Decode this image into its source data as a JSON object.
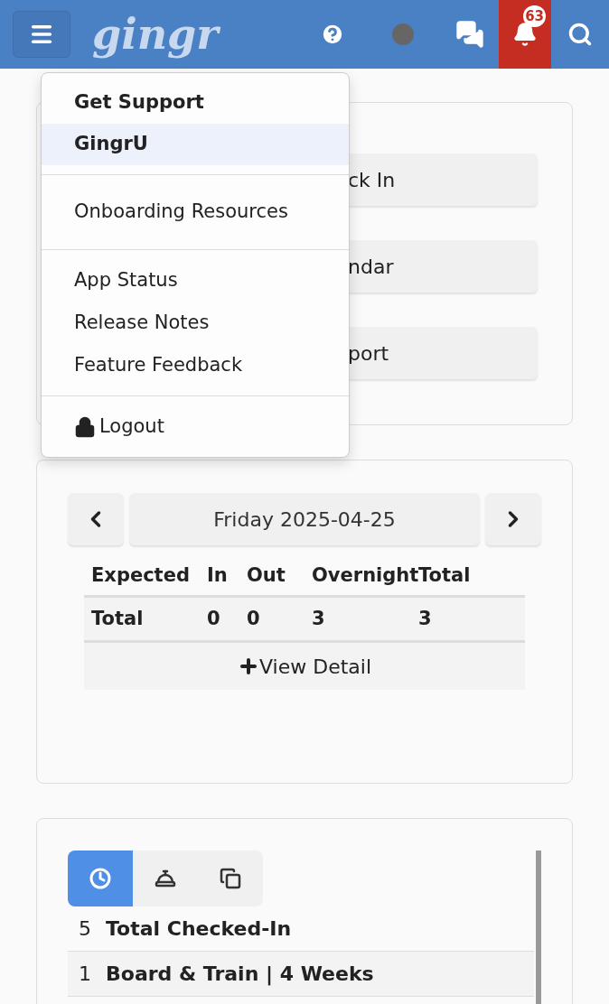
{
  "header": {
    "logo": "gingr",
    "notification_count": "63"
  },
  "menu": {
    "sections": [
      [
        {
          "kind": "heading",
          "label": "Get Support",
          "selected": false
        },
        {
          "kind": "heading",
          "label": "GingrU",
          "selected": true
        }
      ],
      [
        {
          "kind": "link",
          "label": "Onboarding Resources",
          "selected": false
        }
      ],
      [
        {
          "kind": "link",
          "label": "App Status",
          "selected": false
        },
        {
          "kind": "link",
          "label": "Release Notes",
          "selected": false
        },
        {
          "kind": "link",
          "label": "Feature Feedback",
          "selected": false
        }
      ],
      [
        {
          "kind": "logout",
          "label": "Logout",
          "selected": false
        }
      ]
    ]
  },
  "quick_actions": [
    "ck In",
    "ndar",
    "port"
  ],
  "day_summary": {
    "date": "Friday 2025-04-25",
    "columns": [
      "Expected",
      "In",
      "Out",
      "Overnight",
      "Total"
    ],
    "rows": [
      [
        "Total",
        "0",
        "0",
        "3",
        "3"
      ]
    ],
    "view_detail": "View Detail"
  },
  "checked_in": {
    "tabs": [
      {
        "kind": "clock",
        "selected": true
      },
      {
        "kind": "bell",
        "selected": false
      },
      {
        "kind": "copy",
        "selected": false
      }
    ],
    "rows": [
      {
        "count": "5",
        "label": "Total Checked-In"
      },
      {
        "count": "1",
        "label": "Board & Train | 4 Weeks"
      }
    ]
  }
}
